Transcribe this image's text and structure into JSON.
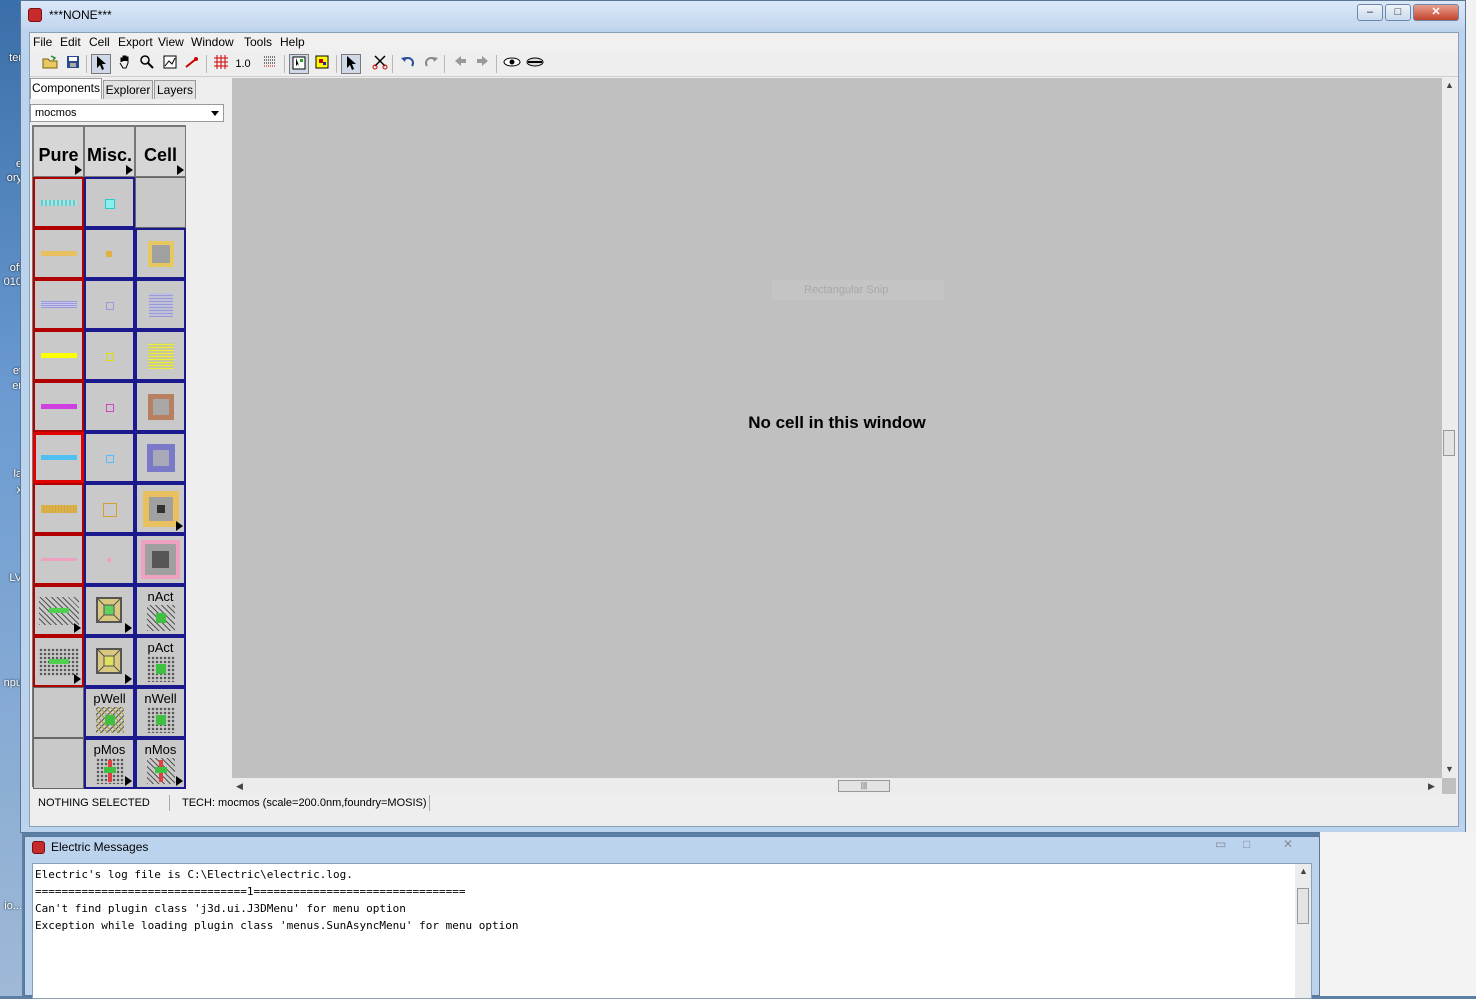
{
  "main_window": {
    "title": "***NONE***",
    "controls": {
      "minimize": "–",
      "maximize": "□",
      "close": "✕"
    }
  },
  "menu": [
    "File",
    "Edit",
    "Cell",
    "Export",
    "View",
    "Window",
    "Tools",
    "Help"
  ],
  "toolbar": {
    "icons": [
      "open-icon",
      "save-icon",
      "select-icon",
      "pan-icon",
      "zoom-icon",
      "outline-icon",
      "measure-icon",
      "grid-icon",
      "grid-align-icon",
      "full-select-icon",
      "special-select-icon",
      "arrow-select-icon",
      "cut-icon",
      "undo-icon",
      "redo-icon",
      "back-icon",
      "forward-icon",
      "show-icon",
      "hide-icon"
    ],
    "grid_value": "1.0"
  },
  "left_panel": {
    "tabs": [
      "Components",
      "Explorer",
      "Layers"
    ],
    "active_tab": "Components",
    "technology": "mocmos",
    "palette_headers": [
      "Pure",
      "Misc.",
      "Cell"
    ],
    "cell_labels": {
      "nact": "nAct",
      "pact": "pAct",
      "pwell": "pWell",
      "nwell": "nWell",
      "pmos": "pMos",
      "nmos": "nMos"
    }
  },
  "canvas": {
    "message": "No cell in this window",
    "overlay": "Rectangular Snip"
  },
  "status_bar": {
    "selection": "NOTHING SELECTED",
    "tech": "TECH: mocmos (scale=200.0nm,foundry=MOSIS)"
  },
  "messages_window": {
    "title": "Electric Messages",
    "lines": [
      "Electric's log file is C:\\Electric\\electric.log.",
      "================================1================================",
      "Can't find plugin class 'j3d.ui.J3DMenu' for menu option",
      "Exception while loading plugin class 'menus.SunAsyncMenu' for menu option"
    ]
  },
  "desktop": {
    "labels": [
      "ter",
      "e",
      "ory",
      "oft",
      "010",
      "et",
      "er",
      "la",
      "x",
      "LV",
      "npu",
      "io..."
    ]
  },
  "colors": {
    "title_bar": "#c3d6ee",
    "canvas_bg": "#c0c0c0",
    "pure_border": "#b00000",
    "misc_border": "#1a1a8e"
  }
}
